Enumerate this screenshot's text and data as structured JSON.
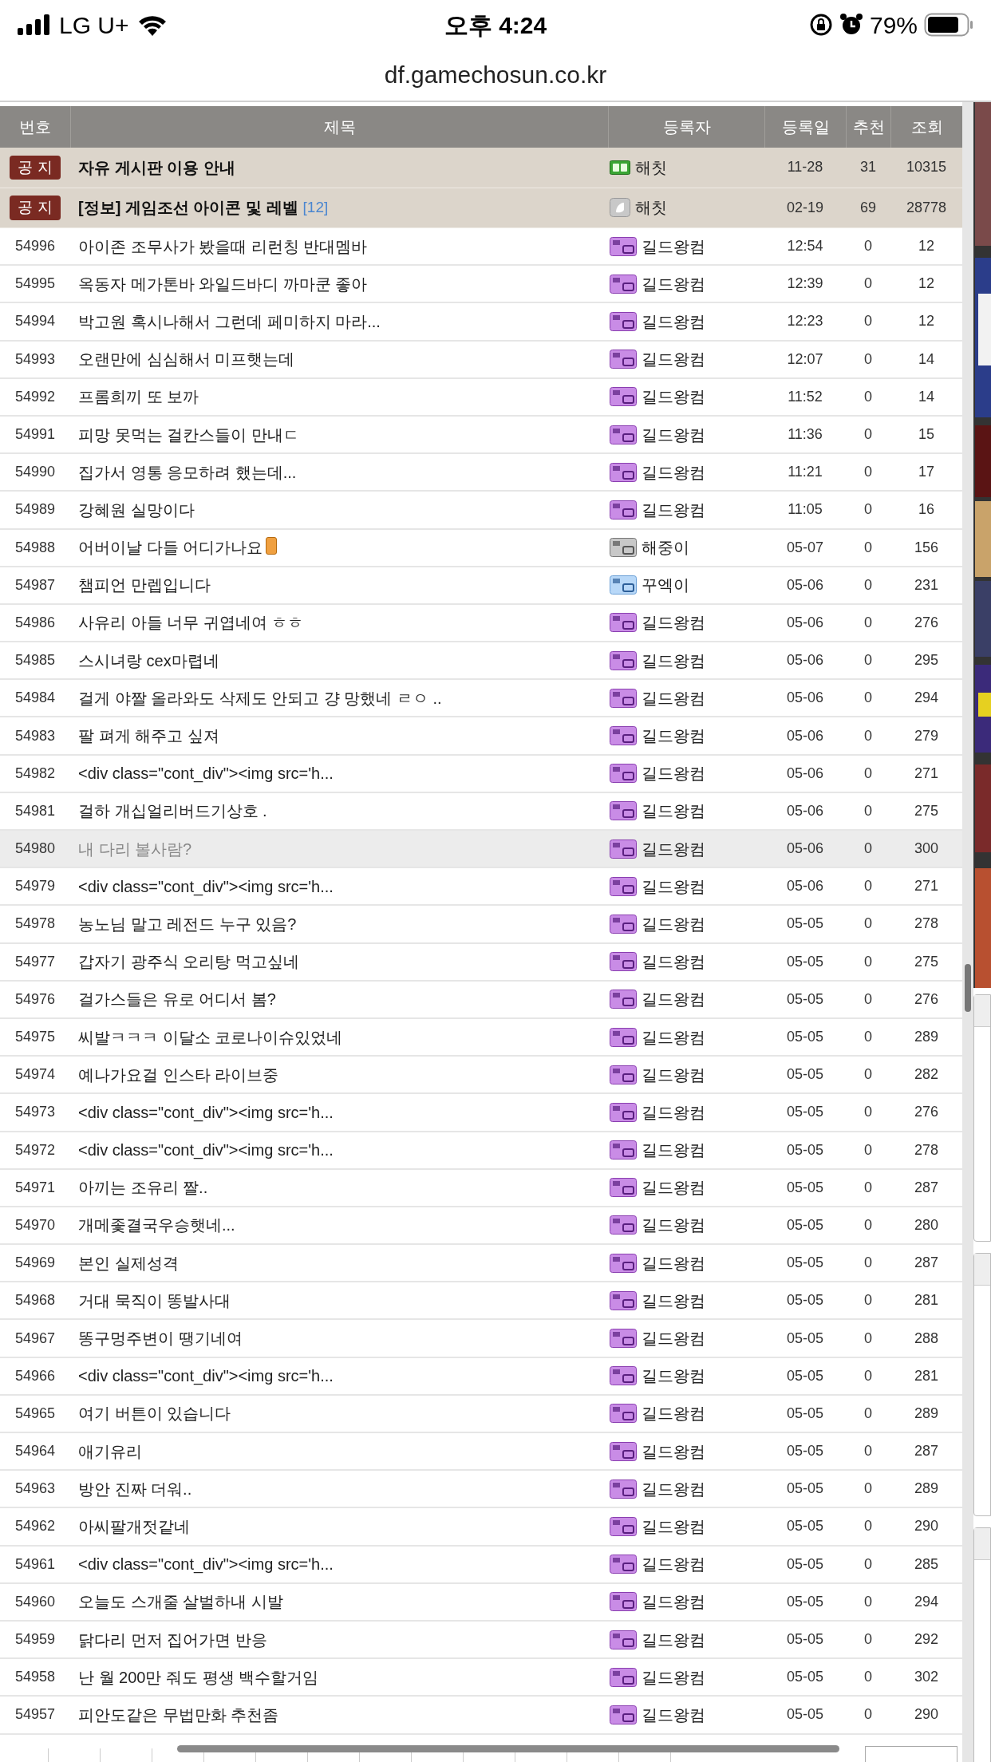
{
  "status_bar": {
    "carrier": "LG U+",
    "time": "오후 4:24",
    "battery": "79%"
  },
  "address_bar": {
    "url": "df.gamechosun.co.kr"
  },
  "table": {
    "columns": [
      "번호",
      "제목",
      "등록자",
      "등록일",
      "추천",
      "조회"
    ],
    "notices": [
      {
        "badge_label": "공 지",
        "title": "자유 게시판 이용 안내",
        "kind": "gc",
        "author": "해칫",
        "date": "11-28",
        "recommend": "31",
        "views": "10315"
      },
      {
        "badge_label": "공 지",
        "title": "[정보] 게임조선 아이콘 및 레벨",
        "comments": "[12]",
        "kind": "white",
        "author": "해칫",
        "date": "02-19",
        "recommend": "69",
        "views": "28778"
      }
    ],
    "rows": [
      {
        "no": "54996",
        "title": "아이존 조무사가 봤을때 리런칭 반대멤바",
        "kind": "purple",
        "author": "길드왕컴",
        "date": "12:54",
        "recommend": "0",
        "views": "12",
        "highlighted": false
      },
      {
        "no": "54995",
        "title": "옥동자 메가톤바 와일드바디 까마쿤 좋아",
        "kind": "purple",
        "author": "길드왕컴",
        "date": "12:39",
        "recommend": "0",
        "views": "12",
        "highlighted": false
      },
      {
        "no": "54994",
        "title": "박고원 혹시나해서 그런데 페미하지 마라...",
        "kind": "purple",
        "author": "길드왕컴",
        "date": "12:23",
        "recommend": "0",
        "views": "12",
        "highlighted": false
      },
      {
        "no": "54993",
        "title": "오랜만에 심심해서 미프햇는데",
        "kind": "purple",
        "author": "길드왕컴",
        "date": "12:07",
        "recommend": "0",
        "views": "14",
        "highlighted": false
      },
      {
        "no": "54992",
        "title": "프롬희끼 또 보까",
        "kind": "purple",
        "author": "길드왕컴",
        "date": "11:52",
        "recommend": "0",
        "views": "14",
        "highlighted": false
      },
      {
        "no": "54991",
        "title": "피망 못먹는 걸칸스들이 만내ㄷ",
        "kind": "purple",
        "author": "길드왕컴",
        "date": "11:36",
        "recommend": "0",
        "views": "15",
        "highlighted": false
      },
      {
        "no": "54990",
        "title": "집가서 영통 응모하려 했는데...",
        "kind": "purple",
        "author": "길드왕컴",
        "date": "11:21",
        "recommend": "0",
        "views": "17",
        "highlighted": false
      },
      {
        "no": "54989",
        "title": "강혜원 실망이다",
        "kind": "purple",
        "author": "길드왕컴",
        "date": "11:05",
        "recommend": "0",
        "views": "16",
        "highlighted": false
      },
      {
        "no": "54988",
        "title": "어버이날 다들 어디가나요",
        "title_icon": {
          "kind": "phone"
        },
        "kind": "gray",
        "author": "해중이",
        "date": "05-07",
        "recommend": "0",
        "views": "156",
        "highlighted": false
      },
      {
        "no": "54987",
        "title": "챔피언 만렙입니다",
        "kind": "blue",
        "author": "꾸엑이",
        "date": "05-06",
        "recommend": "0",
        "views": "231",
        "highlighted": false
      },
      {
        "no": "54986",
        "title": "사유리 아들 너무 귀엽네여 ㅎㅎ",
        "kind": "purple",
        "author": "길드왕컴",
        "date": "05-06",
        "recommend": "0",
        "views": "276",
        "highlighted": false
      },
      {
        "no": "54985",
        "title": "스시녀랑 cex마렵네",
        "kind": "purple",
        "author": "길드왕컴",
        "date": "05-06",
        "recommend": "0",
        "views": "295",
        "highlighted": false
      },
      {
        "no": "54984",
        "title": "걸게 야짤 올라와도 삭제도 안되고 걍 망했네 ㄹㅇ ..",
        "kind": "purple",
        "author": "길드왕컴",
        "date": "05-06",
        "recommend": "0",
        "views": "294",
        "highlighted": false
      },
      {
        "no": "54983",
        "title": "팔 펴게 해주고 싶져",
        "kind": "purple",
        "author": "길드왕컴",
        "date": "05-06",
        "recommend": "0",
        "views": "279",
        "highlighted": false
      },
      {
        "no": "54982",
        "title": "<div class=\"cont_div\"><img src='h...",
        "kind": "purple",
        "author": "길드왕컴",
        "date": "05-06",
        "recommend": "0",
        "views": "271",
        "highlighted": false
      },
      {
        "no": "54981",
        "title": "걸하 개십얼리버드기상호 .",
        "kind": "purple",
        "author": "길드왕컴",
        "date": "05-06",
        "recommend": "0",
        "views": "275",
        "highlighted": false
      },
      {
        "no": "54980",
        "title": "내 다리 볼사람?",
        "kind": "purple",
        "author": "길드왕컴",
        "date": "05-06",
        "recommend": "0",
        "views": "300",
        "highlighted": true
      },
      {
        "no": "54979",
        "title": "<div class=\"cont_div\"><img src='h...",
        "kind": "purple",
        "author": "길드왕컴",
        "date": "05-06",
        "recommend": "0",
        "views": "271",
        "highlighted": false
      },
      {
        "no": "54978",
        "title": "농노님 말고 레전드 누구 있음?",
        "kind": "purple",
        "author": "길드왕컴",
        "date": "05-05",
        "recommend": "0",
        "views": "278",
        "highlighted": false
      },
      {
        "no": "54977",
        "title": "갑자기 광주식 오리탕 먹고싶네",
        "kind": "purple",
        "author": "길드왕컴",
        "date": "05-05",
        "recommend": "0",
        "views": "275",
        "highlighted": false
      },
      {
        "no": "54976",
        "title": "걸가스들은 유로 어디서 봄?",
        "kind": "purple",
        "author": "길드왕컴",
        "date": "05-05",
        "recommend": "0",
        "views": "276",
        "highlighted": false
      },
      {
        "no": "54975",
        "title": "씨발ㅋㅋㅋ 이달소 코로나이슈있었네",
        "kind": "purple",
        "author": "길드왕컴",
        "date": "05-05",
        "recommend": "0",
        "views": "289",
        "highlighted": false
      },
      {
        "no": "54974",
        "title": "예나가요걸 인스타 라이브중",
        "kind": "purple",
        "author": "길드왕컴",
        "date": "05-05",
        "recommend": "0",
        "views": "282",
        "highlighted": false
      },
      {
        "no": "54973",
        "title": "<div class=\"cont_div\"><img src='h...",
        "kind": "purple",
        "author": "길드왕컴",
        "date": "05-05",
        "recommend": "0",
        "views": "276",
        "highlighted": false
      },
      {
        "no": "54972",
        "title": "<div class=\"cont_div\"><img src='h...",
        "kind": "purple",
        "author": "길드왕컴",
        "date": "05-05",
        "recommend": "0",
        "views": "278",
        "highlighted": false
      },
      {
        "no": "54971",
        "title": "아끼는 조유리 짤..",
        "kind": "purple",
        "author": "길드왕컴",
        "date": "05-05",
        "recommend": "0",
        "views": "287",
        "highlighted": false
      },
      {
        "no": "54970",
        "title": "개메좇결국우승햇네...",
        "kind": "purple",
        "author": "길드왕컴",
        "date": "05-05",
        "recommend": "0",
        "views": "280",
        "highlighted": false
      },
      {
        "no": "54969",
        "title": "본인 실제성격",
        "kind": "purple",
        "author": "길드왕컴",
        "date": "05-05",
        "recommend": "0",
        "views": "287",
        "highlighted": false
      },
      {
        "no": "54968",
        "title": "거대 묵직이 똥발사대",
        "kind": "purple",
        "author": "길드왕컴",
        "date": "05-05",
        "recommend": "0",
        "views": "281",
        "highlighted": false
      },
      {
        "no": "54967",
        "title": "똥구멍주변이 땡기네여",
        "kind": "purple",
        "author": "길드왕컴",
        "date": "05-05",
        "recommend": "0",
        "views": "288",
        "highlighted": false
      },
      {
        "no": "54966",
        "title": "<div class=\"cont_div\"><img src='h...",
        "kind": "purple",
        "author": "길드왕컴",
        "date": "05-05",
        "recommend": "0",
        "views": "281",
        "highlighted": false
      },
      {
        "no": "54965",
        "title": "여기 버튼이 있습니다",
        "kind": "purple",
        "author": "길드왕컴",
        "date": "05-05",
        "recommend": "0",
        "views": "289",
        "highlighted": false
      },
      {
        "no": "54964",
        "title": "애기유리",
        "kind": "purple",
        "author": "길드왕컴",
        "date": "05-05",
        "recommend": "0",
        "views": "287",
        "highlighted": false
      },
      {
        "no": "54963",
        "title": "방안 진짜 더워..",
        "kind": "purple",
        "author": "길드왕컴",
        "date": "05-05",
        "recommend": "0",
        "views": "289",
        "highlighted": false
      },
      {
        "no": "54962",
        "title": "아씨팔개젓같네",
        "kind": "purple",
        "author": "길드왕컴",
        "date": "05-05",
        "recommend": "0",
        "views": "290",
        "highlighted": false
      },
      {
        "no": "54961",
        "title": "<div class=\"cont_div\"><img src='h...",
        "kind": "purple",
        "author": "길드왕컴",
        "date": "05-05",
        "recommend": "0",
        "views": "285",
        "highlighted": false
      },
      {
        "no": "54960",
        "title": "오늘도 스개줄 살벌하내 시발",
        "kind": "purple",
        "author": "길드왕컴",
        "date": "05-05",
        "recommend": "0",
        "views": "294",
        "highlighted": false
      },
      {
        "no": "54959",
        "title": "닭다리 먼저 집어가면 반응",
        "kind": "purple",
        "author": "길드왕컴",
        "date": "05-05",
        "recommend": "0",
        "views": "292",
        "highlighted": false
      },
      {
        "no": "54958",
        "title": "난 월 200만 줘도 평생 백수할거임",
        "kind": "purple",
        "author": "길드왕컴",
        "date": "05-05",
        "recommend": "0",
        "views": "302",
        "highlighted": false
      },
      {
        "no": "54957",
        "title": "피안도같은 무법만화 추천좀",
        "kind": "purple",
        "author": "길드왕컴",
        "date": "05-05",
        "recommend": "0",
        "views": "290",
        "highlighted": false
      }
    ]
  }
}
